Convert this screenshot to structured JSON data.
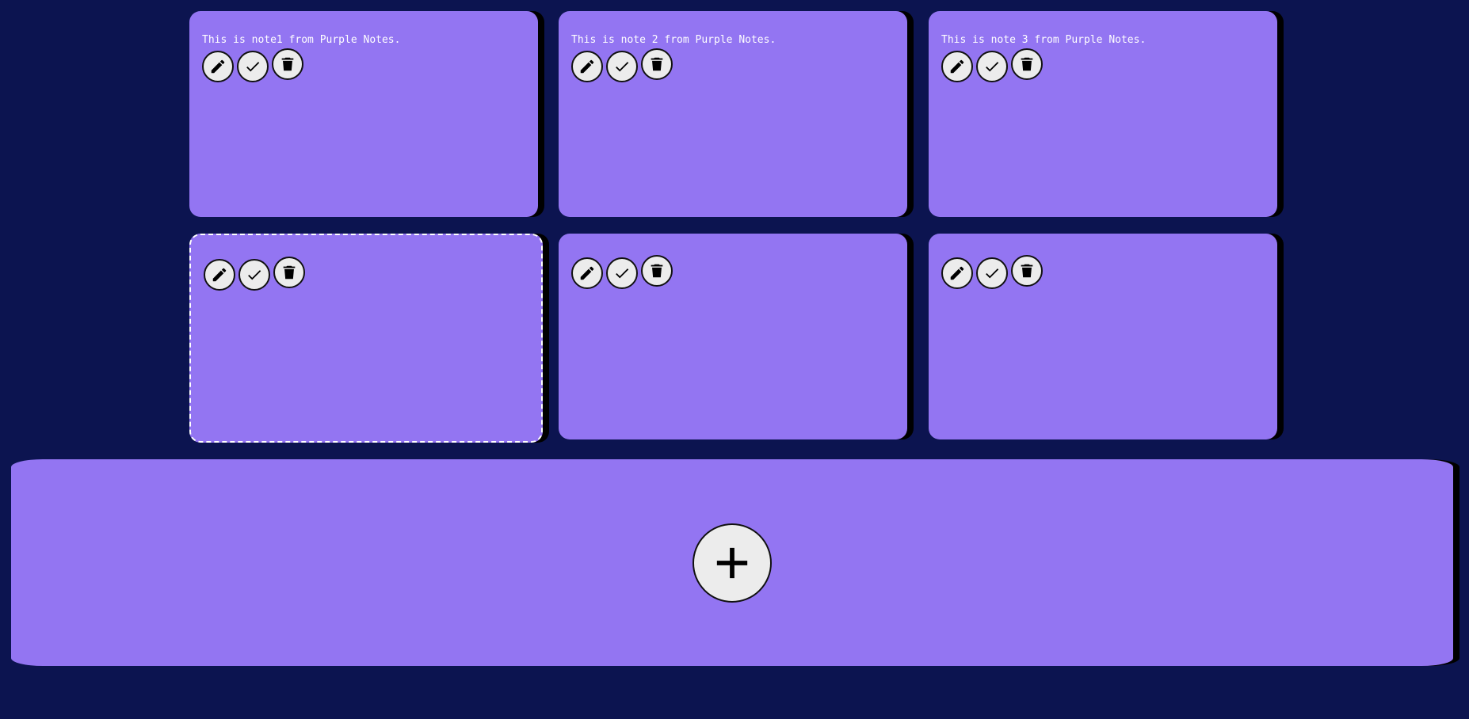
{
  "theme": {
    "background": "#0c1450",
    "note_color": "#9375f2",
    "button_color": "#ececec",
    "text_color": "#ffffff"
  },
  "notes": [
    {
      "text": "This is note1 from Purple Notes.",
      "selected": false
    },
    {
      "text": "This is note 2 from Purple Notes.",
      "selected": false
    },
    {
      "text": "This is note 3 from Purple Notes.",
      "selected": false
    },
    {
      "text": "",
      "selected": true
    },
    {
      "text": "",
      "selected": false
    },
    {
      "text": "",
      "selected": false
    }
  ],
  "icons": {
    "edit": "pencil-icon",
    "complete": "check-icon",
    "delete": "trash-icon",
    "add": "plus-icon"
  }
}
